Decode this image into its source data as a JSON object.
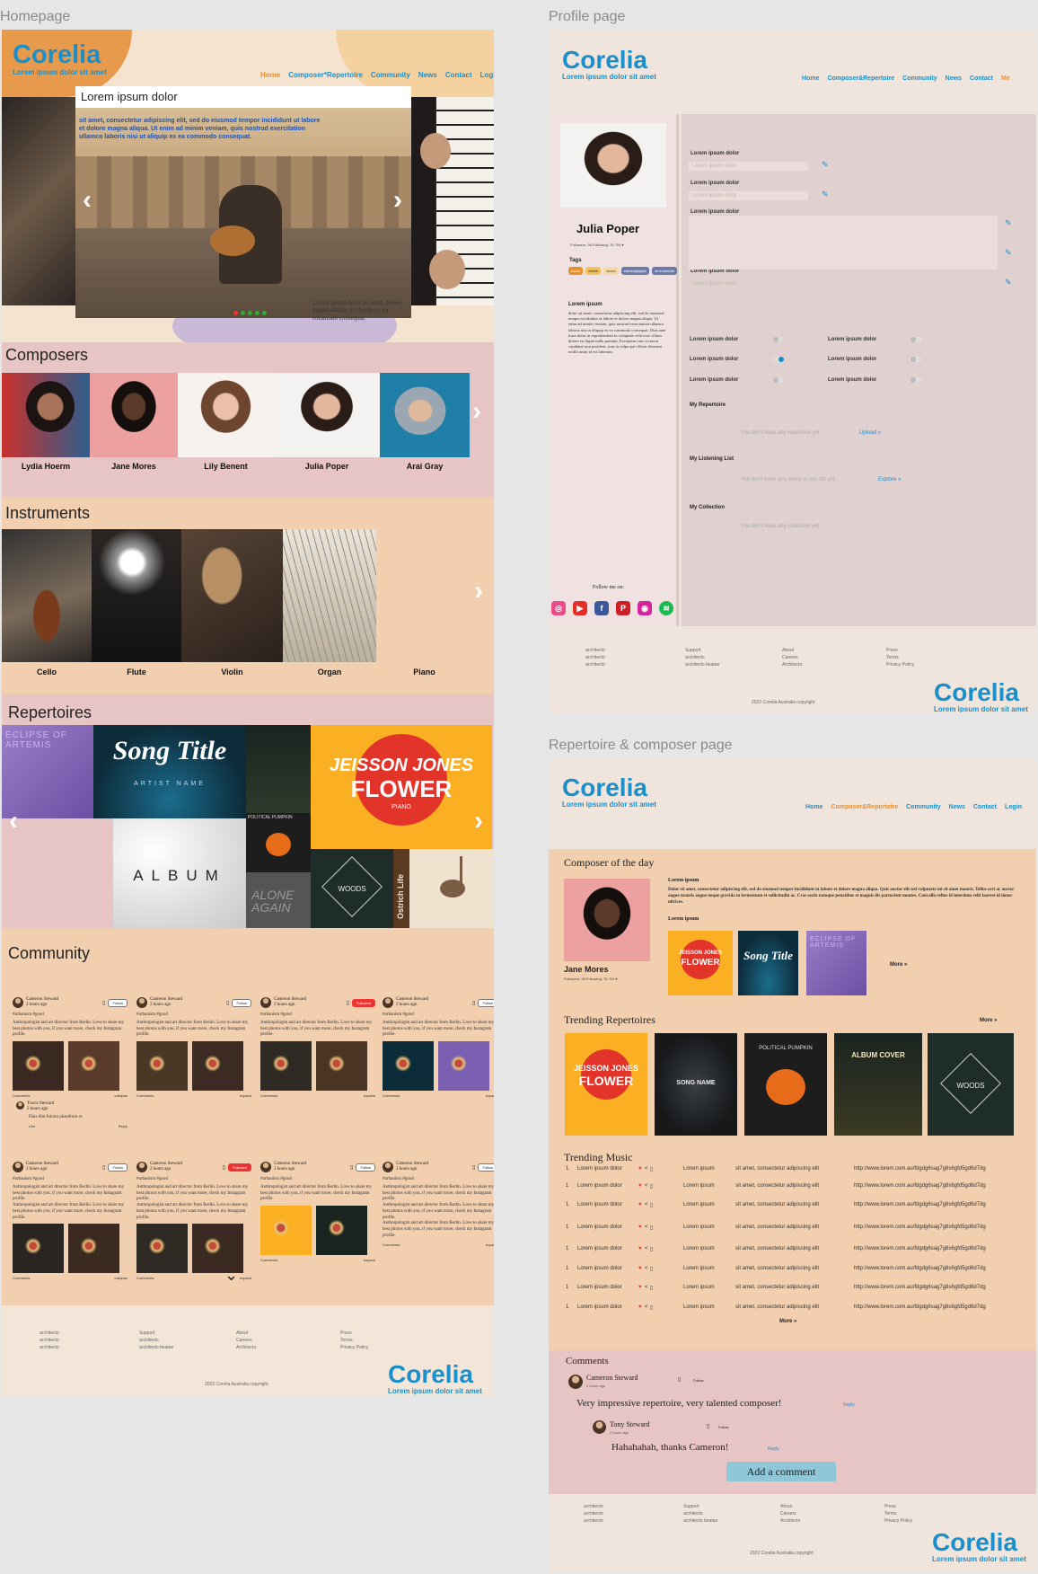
{
  "labels": {
    "homepage": "Homepage",
    "profile": "Profile page",
    "repertoire": "Repertoire & composer page"
  },
  "brand": {
    "name": "Corelia",
    "tagline": "Lorem ipsum dolor sit amet"
  },
  "home": {
    "nav": [
      "Home",
      "Composer*Repertoire",
      "Community",
      "News",
      "Contact",
      "Login"
    ],
    "hero": {
      "title": "Lorem ipsum dolor",
      "text": "sit amet, consectetur adipiscing elit, sed do eiusmod tempor incididunt ut labore et dolore magna aliqua. Ut enim ad minim veniam, quis nostrud exercitation ullamco laboris nisi ut aliquip ex ea commodo consequat.",
      "caption": "Lorem ipsum dolor sit amet, dolore magna aliqua. ut aliquip ex ea commodo consequat."
    },
    "composers_title": "Composers",
    "composers": [
      "Lydia Hoerm",
      "Jane Mores",
      "Lily Benent",
      "Julia Poper",
      "Arai Gray"
    ],
    "instruments_title": "Instruments",
    "instruments": [
      "Cello",
      "Flute",
      "Violin",
      "Organ",
      "Piano"
    ],
    "repertoires_title": "Repertoires",
    "albums": {
      "eclipse": "ECLIPSE OF ARTEMIS",
      "song_title": "Song Title",
      "artist_name": "ARTIST NAME",
      "jeisson": "JEISSON JONES",
      "flower": "FLOWER",
      "piano": "PIANO",
      "album": "ALBUM",
      "political": "POLITICAL PUMPKIN",
      "alone": "ALONE AGAIN",
      "woods": "WOODS",
      "ostrich": "Ostrich Life"
    },
    "community_title": "Community",
    "post": {
      "name": "Cameron Steward",
      "time": "2 hours ago",
      "tags": "#urbanism #good",
      "text": "Anthropologist and art director from Berlin. Love to share my best photos with you, if you want more, check my Instagram profile.",
      "follow": "Follow",
      "followed": "Followed",
      "comments": "Comments",
      "expand": "expand",
      "collapse": "collapse"
    },
    "reply": {
      "name": "Travis Steward",
      "time": "2 hours ago",
      "text": "Duis dim fuinmt phaedrum et.",
      "reply": "Reply",
      "like": "Like"
    },
    "footer": {
      "col1": [
        "architecto",
        "architecto",
        "architecto"
      ],
      "col2": [
        "Support",
        "architecto",
        "architecto beatae"
      ],
      "col3": [
        "About",
        "Careers",
        "Architecto"
      ],
      "col4": [
        "Press",
        "Terms",
        "Privacy Policy"
      ],
      "copyright": "2022 Corelia Australia   copyright"
    }
  },
  "profile": {
    "nav": [
      "Home",
      "Composer&Repertoire",
      "Community",
      "News",
      "Contact",
      "Me"
    ],
    "name": "Julia Poper",
    "stats": "Followers: 96   Following: 76   704 ♥",
    "tags_title": "Tags",
    "tags": [
      "#xxxx",
      "#bbbb",
      "#cccc",
      "#ddddjdjdjdjsk",
      "#rrrrrdddddd"
    ],
    "bio_title": "Lorem ipsum",
    "bio": "dolor sit amet, consectetur adipiscing elit, sed do eiusmod tempor incididunt ut labore et dolore magna aliqua. Ut enim ad minim veniam, quis nostrud exercitation ullamco laboris nisi ut aliquip ex ea commodo consequat. Duis aute irure dolor in reprehenderit in voluptate velit esse cillum dolore eu fugiat nulla pariatur. Excepteur sint occaecat cupidatat non proident, sunt in culpa qui officia deserunt mollit anim id est laborum.",
    "follow_me": "Follow me on:",
    "field_label": "Lorem ipsum dolor",
    "field_placeholder": "Lorem ipsum dolor",
    "toggle_label": "Lorem ipsum dolor",
    "my_repertoire": "My Repertoire",
    "rep_empty": "You don't have any repertoire yet",
    "upload": "Upload »",
    "my_listening": "My Listening List",
    "list_empty": "You don't have any music in you list yet",
    "explore": "Explore »",
    "my_collection": "My Collection",
    "coll_empty": "You don't have any collection yet"
  },
  "rep": {
    "nav": [
      "Home",
      "Composer&Repertoire",
      "Community",
      "News",
      "Contact",
      "Login"
    ],
    "cotd_title": "Composer of the day",
    "cotd_name": "Jane Mores",
    "cotd_stats": "Followers: 96   Following: 76   704 ♥",
    "lorem_title": "Lorem ipsum",
    "lorem_text": "Dolor sit amet, consectetur adipiscing elit, sed do eiusmod tempor incididunt ut labore et dolore magna aliqua. Quis auctor elit sed vulputate mi sit amet mauris. Tellus orci ac auctor augue mauris augue neque gravida in fermentum et sollicitudin ac. Cras sociis natoque penatibus et magnis dis parturient montes. Convallis tellus id interdum velit laoreet id donec ultrices.",
    "lorem_title2": "Lorem ipsum",
    "more": "More »",
    "trending_rep_title": "Trending Repertoires",
    "song_name": "SONG NAME",
    "album_cover": "ALBUM COVER",
    "trending_music_title": "Trending Music",
    "tm_cols": [
      "Lorem ipsum dolor",
      "Lorem ipsum",
      "sit amet, consectetur adipiscing elit",
      "http://www.lorem.com.au/fdgdg6sag7g8s6gfd5gd6d7dg"
    ],
    "tm_num": "1",
    "comments_title": "Comments",
    "c1_name": "Cameron Steward",
    "c1_time": "2 hours ago",
    "c1_text": "Very impressive repertoire, very talented composer!",
    "reply": "Reply",
    "follow": "Follow",
    "c2_name": "Tony Steward",
    "c2_time": "2 hours ago",
    "c2_text": "Hahahahah, thanks Cameron!",
    "add_comment": "Add a comment"
  }
}
